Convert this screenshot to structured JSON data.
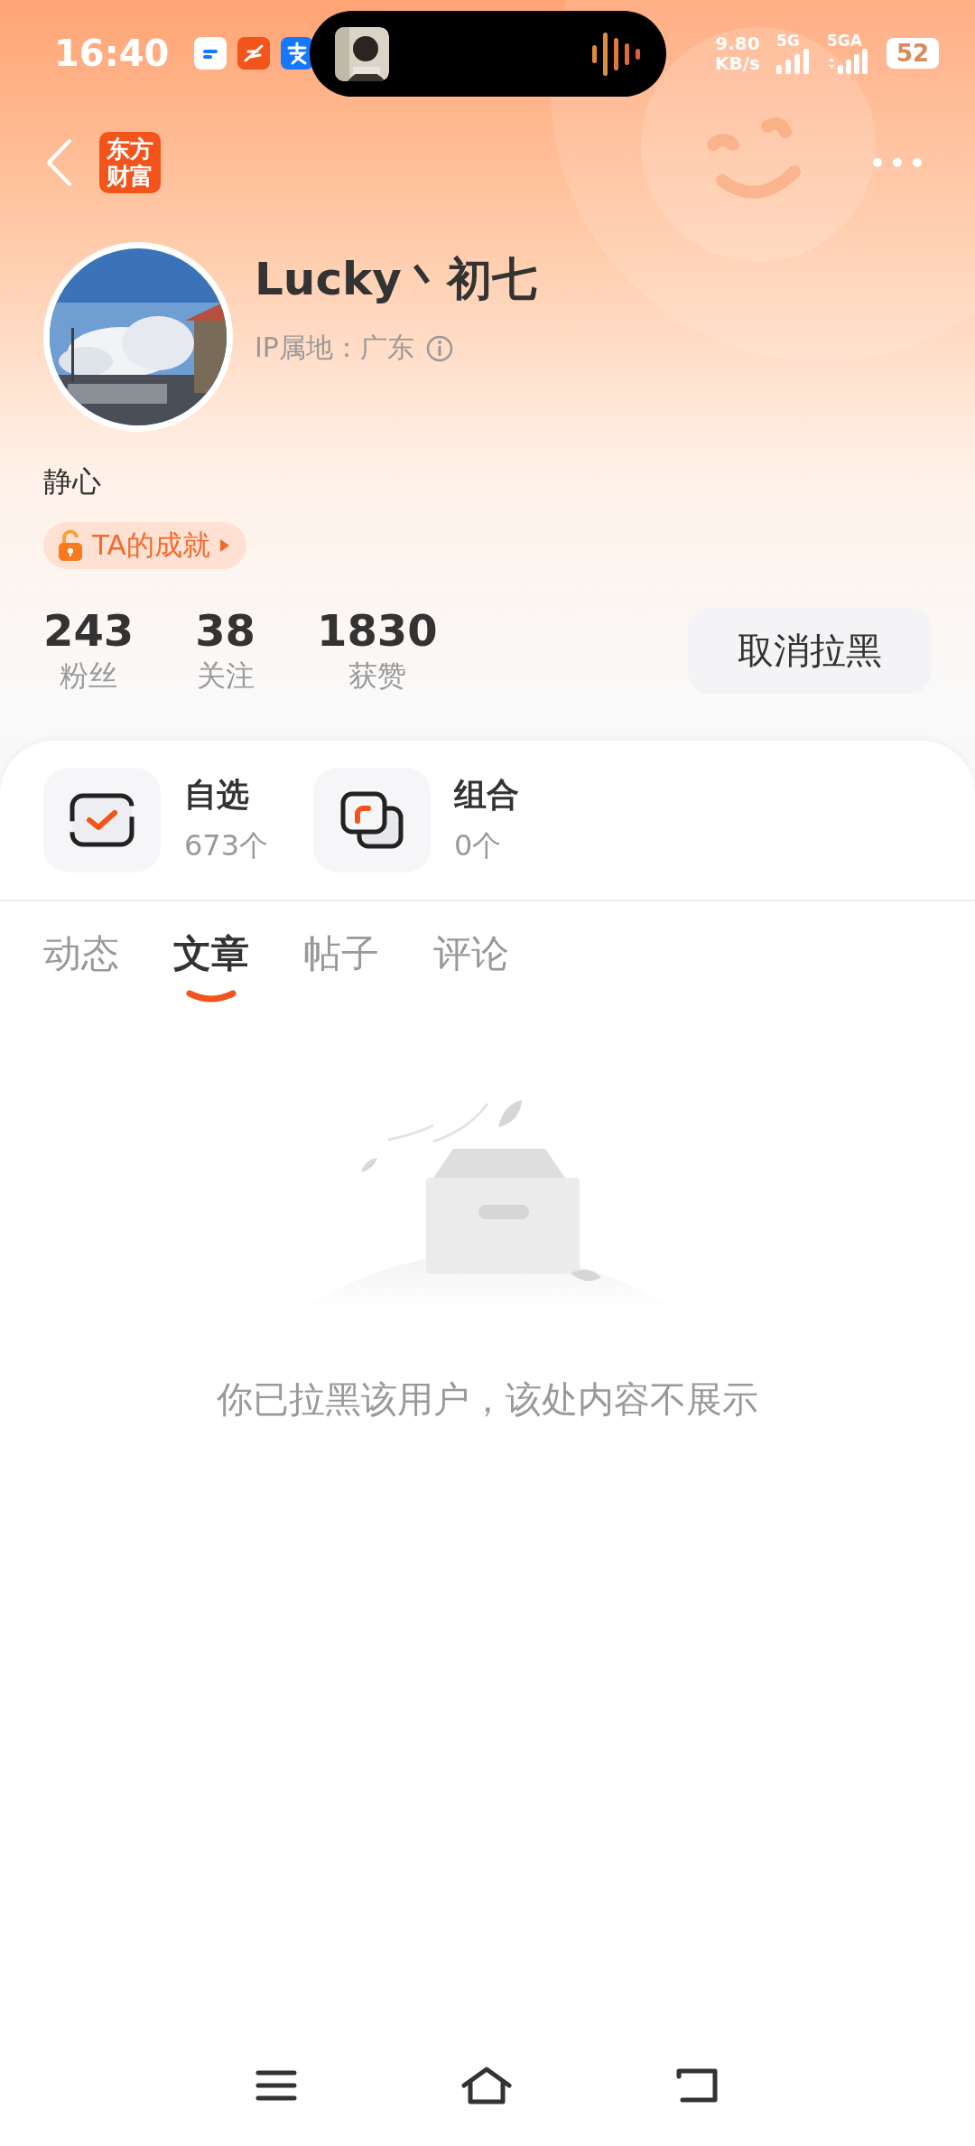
{
  "status_bar": {
    "time": "16:40",
    "net_speed": "9.80",
    "net_unit": "KB/s",
    "signal_1": "5G",
    "signal_2": "5GA",
    "battery": "52"
  },
  "header": {
    "logo_lines": [
      "东方",
      "财富"
    ]
  },
  "profile": {
    "name": "Lucky丶初七",
    "ip_location": "IP属地：广东",
    "bio": "静心",
    "achievement": "TA的成就",
    "stats": [
      {
        "value": "243",
        "label": "粉丝"
      },
      {
        "value": "38",
        "label": "关注"
      },
      {
        "value": "1830",
        "label": "获赞"
      }
    ],
    "action": "取消拉黑"
  },
  "shortcuts": [
    {
      "kind": "watchlist",
      "title": "自选",
      "count": "673个"
    },
    {
      "kind": "portfolio",
      "title": "组合",
      "count": "0个"
    }
  ],
  "tabs": [
    {
      "label": "动态",
      "selected": false
    },
    {
      "label": "文章",
      "selected": true
    },
    {
      "label": "帖子",
      "selected": false
    },
    {
      "label": "评论",
      "selected": false
    }
  ],
  "empty_state": {
    "message": "你已拉黑该用户，该处内容不展示"
  }
}
